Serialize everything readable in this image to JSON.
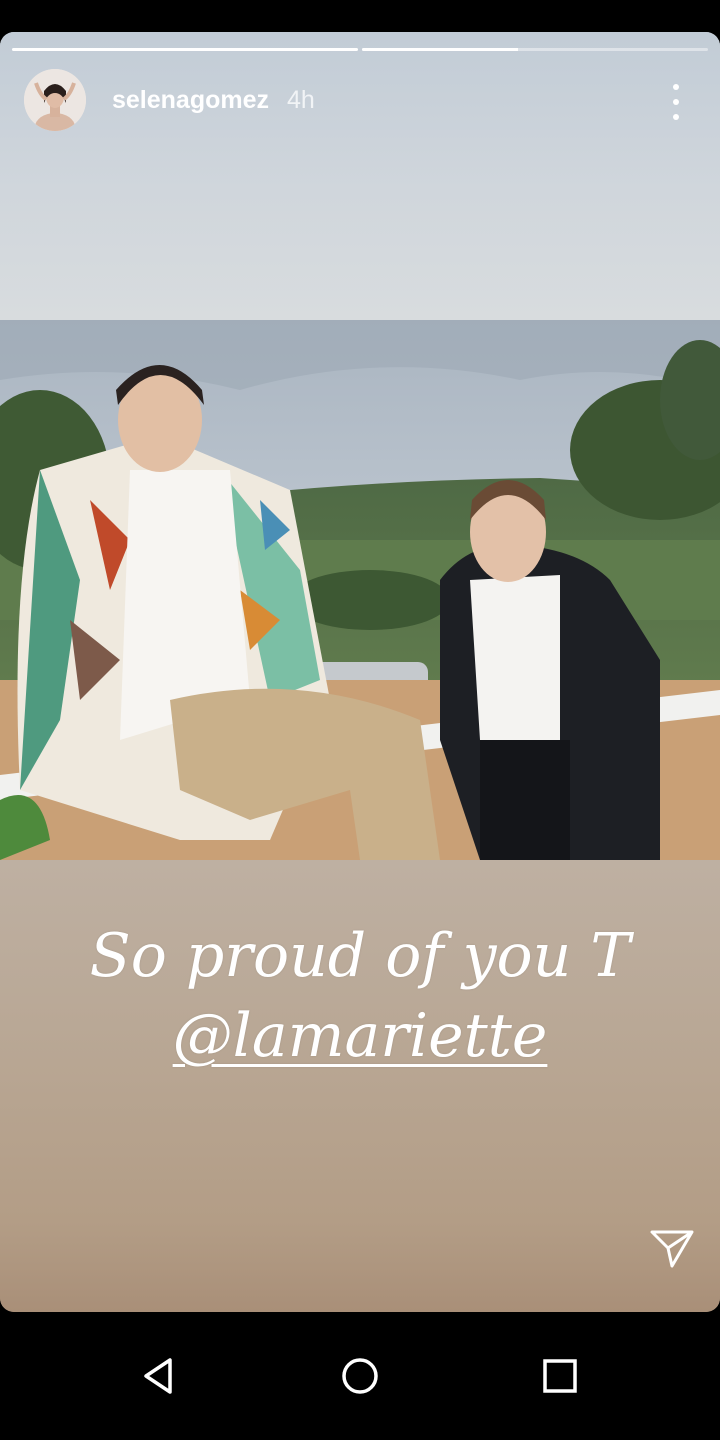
{
  "story": {
    "progress": [
      1.0,
      0.45
    ],
    "username": "selenagomez",
    "time": "4h",
    "caption_line1": "So proud of you T",
    "caption_mention": "@lamariette"
  },
  "icons": {
    "more": "more-vertical-icon",
    "send": "send-icon",
    "nav_back": "back-triangle-icon",
    "nav_home": "home-circle-icon",
    "nav_recents": "recents-square-icon"
  },
  "colors": {
    "progress_fill": "#ffffff",
    "progress_track": "rgba(255,255,255,0.45)",
    "text": "#ffffff"
  }
}
